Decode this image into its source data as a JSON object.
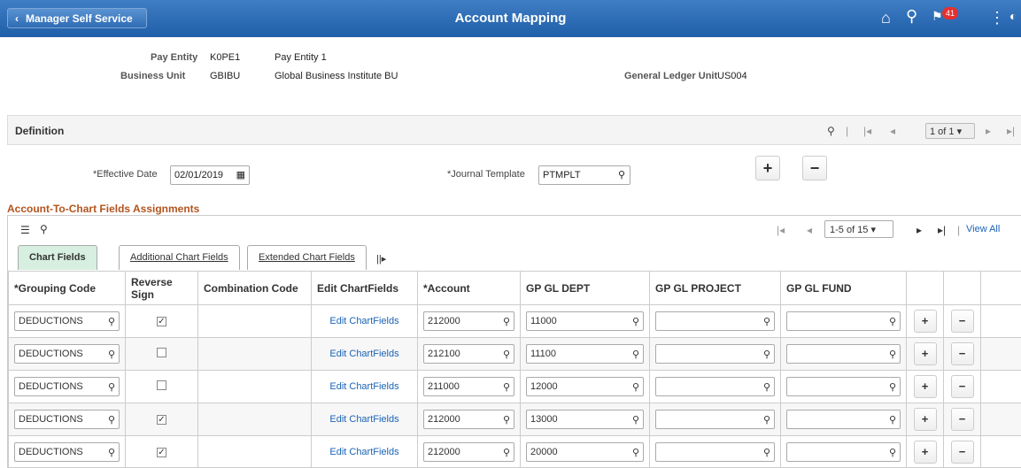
{
  "header": {
    "back_label": "Manager Self Service",
    "title": "Account Mapping",
    "badge_count": "41"
  },
  "info": {
    "pay_entity_label": "Pay Entity",
    "pay_entity_value": "K0PE1",
    "pay_entity_desc": "Pay Entity 1",
    "business_unit_label": "Business Unit",
    "business_unit_value": "GBIBU",
    "business_unit_desc": "Global Business Institute BU",
    "gl_unit_label": "General Ledger Unit",
    "gl_unit_value": "US004"
  },
  "definition": {
    "title": "Definition",
    "pager": "1 of 1",
    "effective_date_label": "*Effective Date",
    "effective_date": "02/01/2019",
    "journal_template_label": "*Journal Template",
    "journal_template": "PTMPLT"
  },
  "assignments": {
    "title": "Account-To-Chart Fields Assignments",
    "pager": "1-5 of 15",
    "view_all": "View All",
    "tabs": [
      "Chart Fields",
      "Additional Chart Fields",
      "Extended Chart Fields"
    ],
    "columns": [
      "*Grouping Code",
      "Reverse Sign",
      "Combination Code",
      "Edit ChartFields",
      "*Account",
      "GP GL DEPT",
      "GP GL PROJECT",
      "GP GL FUND"
    ],
    "rows": [
      {
        "grouping": "DEDUCTIONS",
        "reverse": "✓",
        "edit": "Edit ChartFields",
        "account": "212000",
        "dept": "11000"
      },
      {
        "grouping": "DEDUCTIONS",
        "reverse": "",
        "edit": "Edit ChartFields",
        "account": "212100",
        "dept": "11100"
      },
      {
        "grouping": "DEDUCTIONS",
        "reverse": "",
        "edit": "Edit ChartFields",
        "account": "211000",
        "dept": "12000"
      },
      {
        "grouping": "DEDUCTIONS",
        "reverse": "✓",
        "edit": "Edit ChartFields",
        "account": "212000",
        "dept": "13000"
      },
      {
        "grouping": "DEDUCTIONS",
        "reverse": "✓",
        "edit": "Edit ChartFields",
        "account": "212000",
        "dept": "20000"
      }
    ]
  }
}
